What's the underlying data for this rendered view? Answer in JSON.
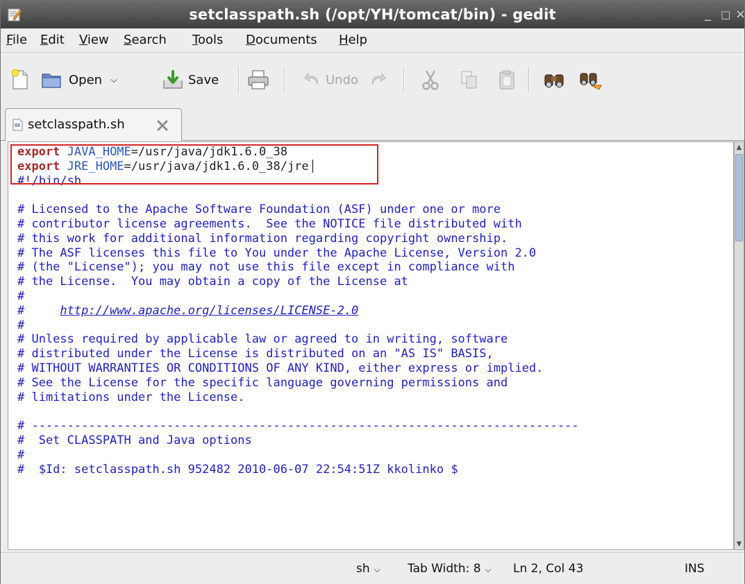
{
  "window": {
    "title": "setclasspath.sh (/opt/YH/tomcat/bin) - gedit",
    "minimize": "_",
    "maximize": "□",
    "close": "×"
  },
  "menu": [
    {
      "first": "F",
      "rest": "ile"
    },
    {
      "first": "E",
      "rest": "dit"
    },
    {
      "first": "V",
      "rest": "iew"
    },
    {
      "first": "S",
      "rest": "earch"
    },
    {
      "first": "T",
      "rest": "ools"
    },
    {
      "first": "D",
      "rest": "ocuments"
    },
    {
      "first": "H",
      "rest": "elp"
    }
  ],
  "toolbar": {
    "open_label": "Open",
    "save_label": "Save",
    "undo_label": "Undo"
  },
  "tab": {
    "label": "setclasspath.sh"
  },
  "editor": {
    "lines": [
      [
        {
          "t": "kw",
          "v": "export"
        },
        {
          "t": "var",
          "v": " JAVA_HOME"
        },
        {
          "t": "txt",
          "v": "=/usr/java/jdk1.6.0_38"
        }
      ],
      [
        {
          "t": "kw",
          "v": "export"
        },
        {
          "t": "var",
          "v": " JRE_HOME"
        },
        {
          "t": "txt",
          "v": "=/usr/java/jdk1.6.0_38/jre"
        }
      ],
      [
        {
          "t": "cmt",
          "v": "#!/bin/sh"
        }
      ],
      [],
      [
        {
          "t": "cmt",
          "v": "# Licensed to the Apache Software Foundation (ASF) under one or more"
        }
      ],
      [
        {
          "t": "cmt",
          "v": "# contributor license agreements.  See the NOTICE file distributed with"
        }
      ],
      [
        {
          "t": "cmt",
          "v": "# this work for additional information regarding copyright ownership."
        }
      ],
      [
        {
          "t": "cmt",
          "v": "# The ASF licenses this file to You under the Apache License, Version 2.0"
        }
      ],
      [
        {
          "t": "cmt",
          "v": "# (the \"License\"); you may not use this file except in compliance with"
        }
      ],
      [
        {
          "t": "cmt",
          "v": "# the License.  You may obtain a copy of the License at"
        }
      ],
      [
        {
          "t": "cmt",
          "v": "#"
        }
      ],
      [
        {
          "t": "cmt",
          "v": "#     "
        },
        {
          "t": "url",
          "v": "http://www.apache.org/licenses/LICENSE-2.0"
        }
      ],
      [
        {
          "t": "cmt",
          "v": "#"
        }
      ],
      [
        {
          "t": "cmt",
          "v": "# Unless required by applicable law or agreed to in writing, software"
        }
      ],
      [
        {
          "t": "cmt",
          "v": "# distributed under the License is distributed on an \"AS IS\" BASIS,"
        }
      ],
      [
        {
          "t": "cmt",
          "v": "# WITHOUT WARRANTIES OR CONDITIONS OF ANY KIND, either express or implied."
        }
      ],
      [
        {
          "t": "cmt",
          "v": "# See the License for the specific language governing permissions and"
        }
      ],
      [
        {
          "t": "cmt",
          "v": "# limitations under the License."
        }
      ],
      [],
      [
        {
          "t": "cmt",
          "v": "# -----------------------------------------------------------------------------"
        }
      ],
      [
        {
          "t": "cmt",
          "v": "#  Set CLASSPATH and Java options"
        }
      ],
      [
        {
          "t": "cmt",
          "v": "#"
        }
      ],
      [
        {
          "t": "cmt",
          "v": "#  $Id: setclasspath.sh 952482 2010-06-07 22:54:51Z kkolinko $"
        }
      ]
    ]
  },
  "status": {
    "language": "sh",
    "tab_width": "Tab Width: 8",
    "position": "Ln 2, Col 43",
    "mode": "INS"
  }
}
